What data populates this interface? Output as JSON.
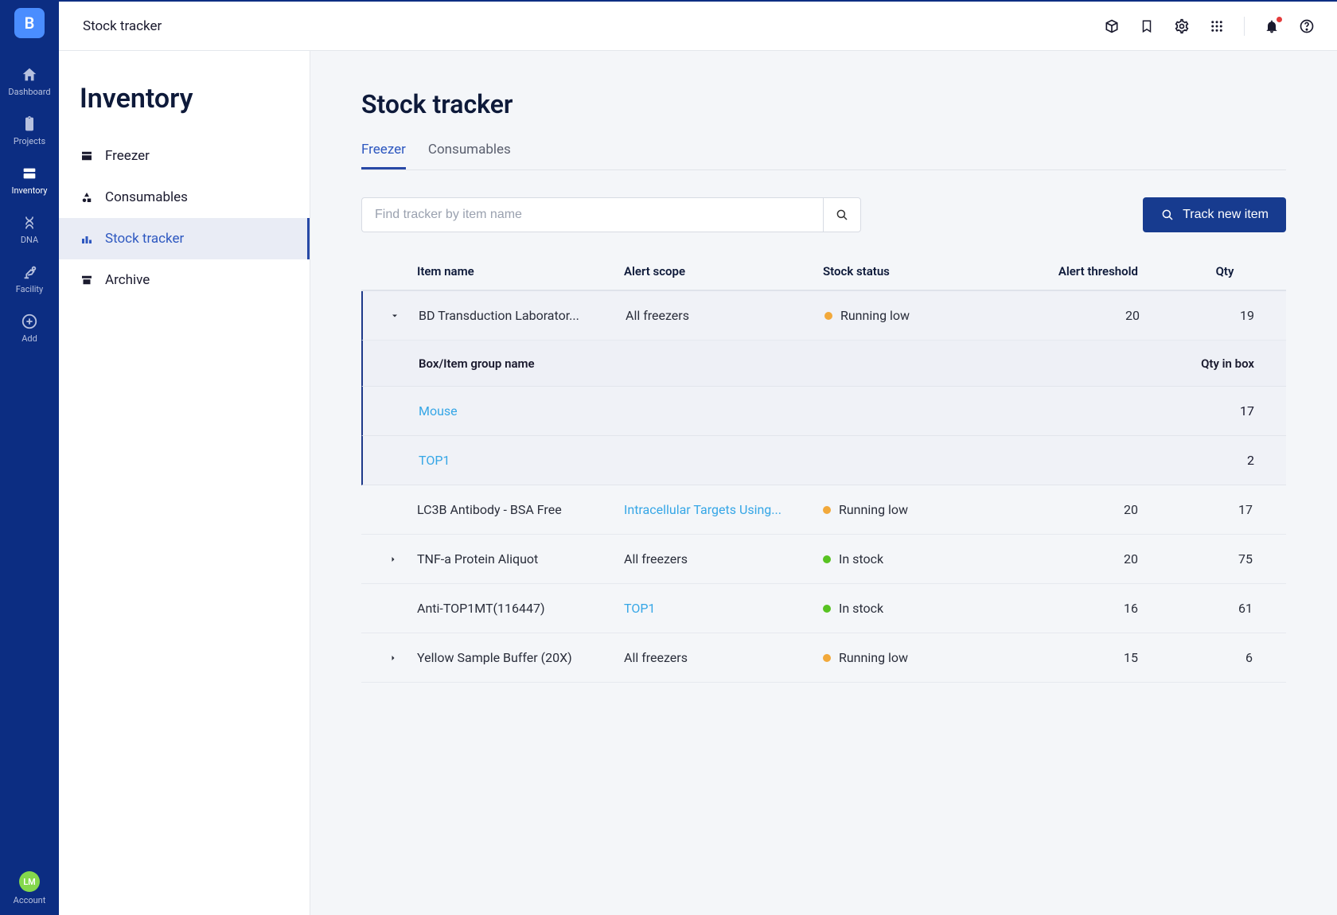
{
  "brand_letter": "B",
  "rail": {
    "items": [
      {
        "key": "dashboard",
        "label": "Dashboard"
      },
      {
        "key": "projects",
        "label": "Projects"
      },
      {
        "key": "inventory",
        "label": "Inventory"
      },
      {
        "key": "dna",
        "label": "DNA"
      },
      {
        "key": "facility",
        "label": "Facility"
      },
      {
        "key": "add",
        "label": "Add"
      }
    ],
    "active_key": "inventory",
    "account": {
      "initials": "LM",
      "label": "Account"
    }
  },
  "topbar": {
    "title": "Stock tracker"
  },
  "subnav": {
    "title": "Inventory",
    "items": [
      {
        "key": "freezer",
        "label": "Freezer"
      },
      {
        "key": "consumables",
        "label": "Consumables"
      },
      {
        "key": "stock-tracker",
        "label": "Stock tracker"
      },
      {
        "key": "archive",
        "label": "Archive"
      }
    ],
    "active_key": "stock-tracker"
  },
  "page": {
    "title": "Stock tracker",
    "tabs": [
      {
        "key": "freezer",
        "label": "Freezer"
      },
      {
        "key": "consumables",
        "label": "Consumables"
      }
    ],
    "active_tab": "freezer",
    "search": {
      "placeholder": "Find tracker by item name"
    },
    "track_button": "Track new item",
    "columns": {
      "item_name": "Item name",
      "alert_scope": "Alert scope",
      "stock_status": "Stock status",
      "alert_threshold": "Alert threshold",
      "qty": "Qty"
    },
    "sub_columns": {
      "box_name": "Box/Item group name",
      "qty_in_box": "Qty in box"
    },
    "status_labels": {
      "low": "Running low",
      "ok": "In stock"
    },
    "rows": [
      {
        "expandable": true,
        "expanded": true,
        "item_name": "BD Transduction Laborator...",
        "alert_scope": "All freezers",
        "alert_scope_is_link": false,
        "status": "low",
        "threshold": "20",
        "qty": "19",
        "children": [
          {
            "name": "Mouse",
            "qty": "17"
          },
          {
            "name": "TOP1",
            "qty": "2"
          }
        ]
      },
      {
        "expandable": false,
        "expanded": false,
        "item_name": "LC3B Antibody - BSA Free",
        "alert_scope": "Intracellular Targets Using...",
        "alert_scope_is_link": true,
        "status": "low",
        "threshold": "20",
        "qty": "17"
      },
      {
        "expandable": true,
        "expanded": false,
        "item_name": "TNF-a Protein Aliquot",
        "alert_scope": "All freezers",
        "alert_scope_is_link": false,
        "status": "ok",
        "threshold": "20",
        "qty": "75"
      },
      {
        "expandable": false,
        "expanded": false,
        "item_name": "Anti-TOP1MT(116447)",
        "alert_scope": "TOP1",
        "alert_scope_is_link": true,
        "status": "ok",
        "threshold": "16",
        "qty": "61"
      },
      {
        "expandable": true,
        "expanded": false,
        "item_name": "Yellow Sample Buffer (20X)",
        "alert_scope": "All freezers",
        "alert_scope_is_link": false,
        "status": "low",
        "threshold": "15",
        "qty": "6"
      }
    ]
  }
}
